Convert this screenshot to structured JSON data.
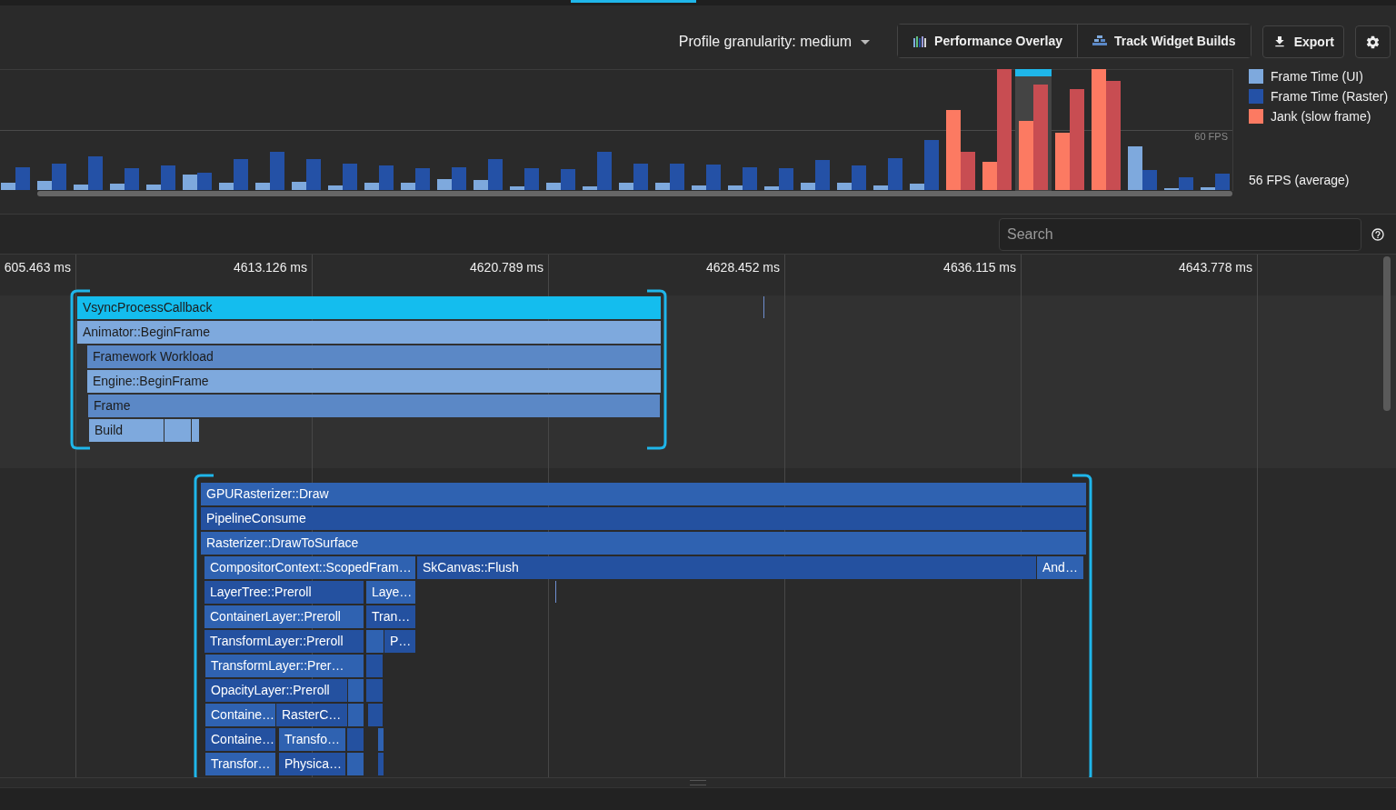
{
  "toolbar": {
    "granularity": "Profile granularity: medium",
    "toggles": [
      {
        "kind": "overlay",
        "label": "Performance Overlay"
      },
      {
        "kind": "widgets",
        "label": "Track Widget Builds"
      }
    ],
    "export": "Export"
  },
  "frame_chart": {
    "fps_line_label": "60 FPS",
    "legend": [
      {
        "label": "Frame Time (UI)",
        "color": "#7ea9dd"
      },
      {
        "label": "Frame Time (Raster)",
        "color": "#2451a6"
      },
      {
        "label": "Jank (slow frame)",
        "color": "#fc7a62"
      }
    ],
    "average": "56 FPS (average)"
  },
  "search": {
    "placeholder": "Search"
  },
  "timeline": {
    "ticks": [
      "605.463 ms",
      "4613.126 ms",
      "4620.789 ms",
      "4628.452 ms",
      "4636.115 ms",
      "4643.778 ms"
    ],
    "ui_rows": [
      [
        {
          "kind": "event",
          "label": "VsyncProcessCallback"
        }
      ],
      [
        {
          "kind": "event",
          "label": "Animator::BeginFrame"
        }
      ],
      [
        {
          "kind": "event",
          "label": "Framework Workload"
        }
      ],
      [
        {
          "kind": "event",
          "label": "Engine::BeginFrame"
        }
      ],
      [
        {
          "kind": "event",
          "label": "Frame"
        }
      ],
      [
        {
          "kind": "event",
          "label": "Build"
        },
        {
          "kind": "slice"
        },
        {
          "kind": "slice"
        }
      ]
    ],
    "raster_rows": [
      [
        {
          "kind": "event",
          "label": "GPURasterizer::Draw"
        }
      ],
      [
        {
          "kind": "event",
          "label": "PipelineConsume"
        }
      ],
      [
        {
          "kind": "event",
          "label": "Rasterizer::DrawToSurface"
        }
      ],
      [
        {
          "kind": "event",
          "label": "CompositorContext::ScopedFram…"
        },
        {
          "kind": "event",
          "label": "SkCanvas::Flush"
        },
        {
          "kind": "event",
          "label": "And…"
        }
      ],
      [
        {
          "kind": "event",
          "label": "LayerTree::Preroll"
        },
        {
          "kind": "event",
          "label": "Laye…"
        }
      ],
      [
        {
          "kind": "event",
          "label": "ContainerLayer::Preroll"
        },
        {
          "kind": "event",
          "label": "Tran…"
        }
      ],
      [
        {
          "kind": "event",
          "label": "TransformLayer::Preroll"
        },
        {
          "kind": "slice"
        },
        {
          "kind": "event",
          "label": "P…"
        }
      ],
      [
        {
          "kind": "event",
          "label": "TransformLayer::Prer…"
        },
        {
          "kind": "slice"
        }
      ],
      [
        {
          "kind": "event",
          "label": "OpacityLayer::Preroll"
        },
        {
          "kind": "slice"
        },
        {
          "kind": "slice"
        }
      ],
      [
        {
          "kind": "event",
          "label": "Containe…"
        },
        {
          "kind": "event",
          "label": "RasterC…"
        },
        {
          "kind": "slice"
        },
        {
          "kind": "slice"
        }
      ],
      [
        {
          "kind": "event",
          "label": "Containe…"
        },
        {
          "kind": "event",
          "label": "Transfo…"
        },
        {
          "kind": "slice"
        },
        {
          "kind": "slice"
        }
      ],
      [
        {
          "kind": "event",
          "label": "Transfor…"
        },
        {
          "kind": "event",
          "label": "Physica…"
        },
        {
          "kind": "slice"
        },
        {
          "kind": "slice"
        }
      ]
    ]
  }
}
